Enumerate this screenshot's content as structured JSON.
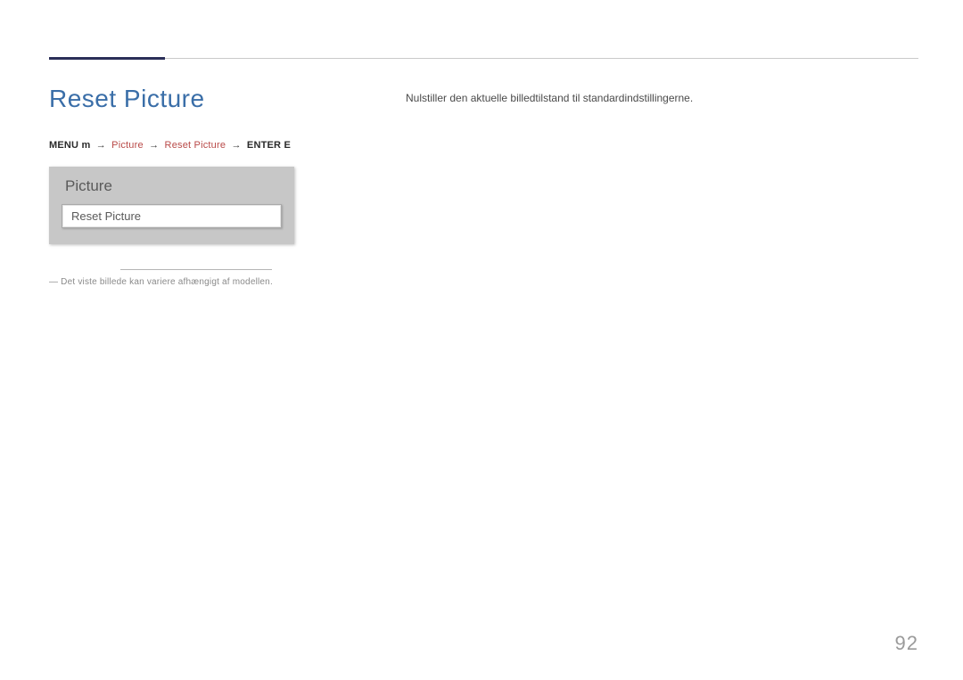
{
  "header": {
    "title": "Reset Picture"
  },
  "breadcrumb": {
    "menu": "MENU m",
    "picture": "Picture",
    "reset_picture": "Reset Picture",
    "enter": "ENTER E"
  },
  "osd": {
    "panel_title": "Picture",
    "row_label": "Reset Picture"
  },
  "footnote": {
    "text": "― Det viste billede kan variere afhængigt af modellen."
  },
  "description": {
    "text": "Nulstiller den aktuelle billedtilstand til standardindstillingerne."
  },
  "page_number": "92"
}
